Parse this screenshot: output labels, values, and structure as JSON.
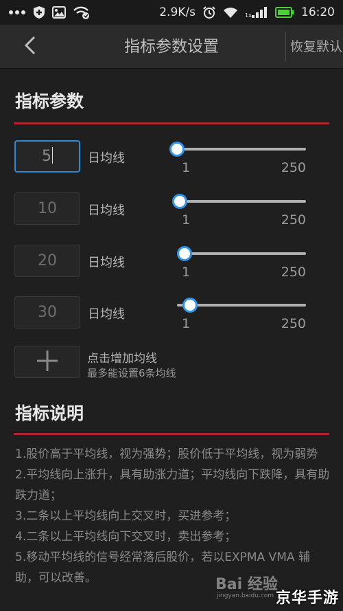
{
  "statusbar": {
    "speed": "2.9K/s",
    "time": "16:20",
    "sim_label": "1x",
    "icons": [
      "more-icon",
      "shield-icon",
      "image-icon",
      "wifi-sync-icon",
      "alarm-icon",
      "wifi-icon",
      "signal-icon",
      "battery-icon"
    ]
  },
  "header": {
    "title": "指标参数设置",
    "reset_label": "恢复默认"
  },
  "params_section": {
    "title": "指标参数",
    "rows": [
      {
        "value": "5",
        "unit": "日均线",
        "slider_min": "1",
        "slider_max": "250",
        "slider_fraction": 0.0,
        "focused": true
      },
      {
        "value": "10",
        "unit": "日均线",
        "slider_min": "1",
        "slider_max": "250",
        "slider_fraction": 0.02,
        "focused": false
      },
      {
        "value": "20",
        "unit": "日均线",
        "slider_min": "1",
        "slider_max": "250",
        "slider_fraction": 0.06,
        "focused": false
      },
      {
        "value": "30",
        "unit": "日均线",
        "slider_min": "1",
        "slider_max": "250",
        "slider_fraction": 0.1,
        "focused": false
      }
    ],
    "add": {
      "label": "点击增加均线",
      "hint": "最多能设置6条均线"
    }
  },
  "desc_section": {
    "title": "指标说明",
    "lines": [
      "1.股价高于平均线，视为强势；股价低于平均线，视为弱势",
      "2.平均线向上涨升，具有助涨力道；平均线向下跌降，具有助跌力道；",
      "3.二条以上平均线向上交叉时，买进参考；",
      "4.二条以上平均线向下交叉时，卖出参考；",
      "5.移动平均线的信号经常落后股价，若以EXPMA VMA 辅助，可以改善。"
    ]
  },
  "watermark": {
    "brand": "Bai 经验",
    "sub": "jingyan.baidu.com",
    "tag": "京华手游"
  },
  "colors": {
    "accent_red": "#b3232d",
    "slider_blue": "#2f95e8",
    "focus_blue": "#2a8ad8",
    "battery_green": "#4cd137"
  }
}
